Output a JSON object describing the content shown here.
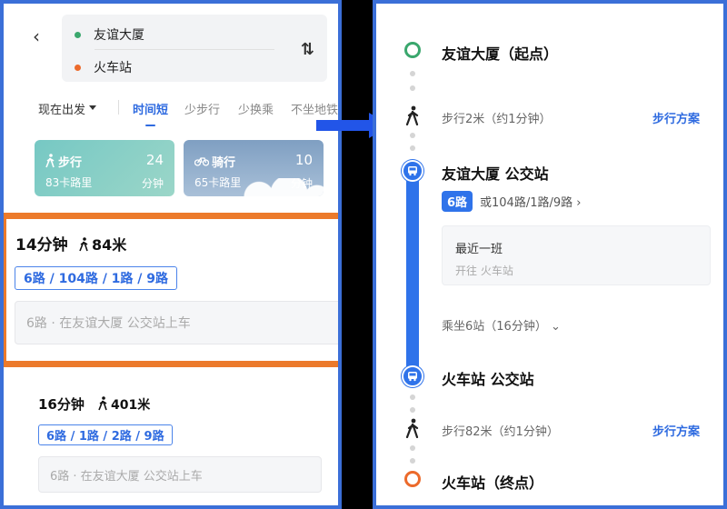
{
  "left": {
    "back_icon": "chevron-left-icon",
    "from_name": "友谊大厦",
    "to_name": "火车站",
    "from_color": "#3aa76d",
    "to_color": "#ec6a2b",
    "swap_icon": "swap-icon",
    "depart_label": "现在出发",
    "tabs": [
      "时间短",
      "少步行",
      "少换乘",
      "不坐地铁"
    ],
    "walk_card": {
      "title": "步行",
      "sub": "83卡路里",
      "num": "24",
      "unit": "分钟"
    },
    "ride_card": {
      "title": "骑行",
      "sub": "65卡路里",
      "num": "10",
      "unit": "分钟"
    },
    "plans": [
      {
        "time": "14分钟",
        "walk": "84米",
        "lines": "6路 / 104路 / 1路 / 9路",
        "hint": "6路 · 在友谊大厦 公交站上车"
      },
      {
        "time": "16分钟",
        "walk": "401米",
        "lines": "6路 / 1路 / 2路 / 9路",
        "hint": "6路 · 在友谊大厦 公交站上车"
      }
    ]
  },
  "right": {
    "start": "友谊大厦（起点）",
    "walk1": "步行2米（约1分钟）",
    "walk_plan": "步行方案",
    "board_stop": "友谊大厦 公交站",
    "chip": "6路",
    "alt_lines": "或104路/1路/9路",
    "latest_title": "最近一班",
    "latest_sub": "开往 火车站",
    "ride_info": "乘坐6站（16分钟）",
    "alight_stop": "火车站 公交站",
    "walk2": "步行82米（约1分钟）",
    "end": "火车站（终点）"
  },
  "colors": {
    "accent": "#2f6be0",
    "highlight": "#ec7a2b",
    "frame": "#3b6fd8"
  }
}
